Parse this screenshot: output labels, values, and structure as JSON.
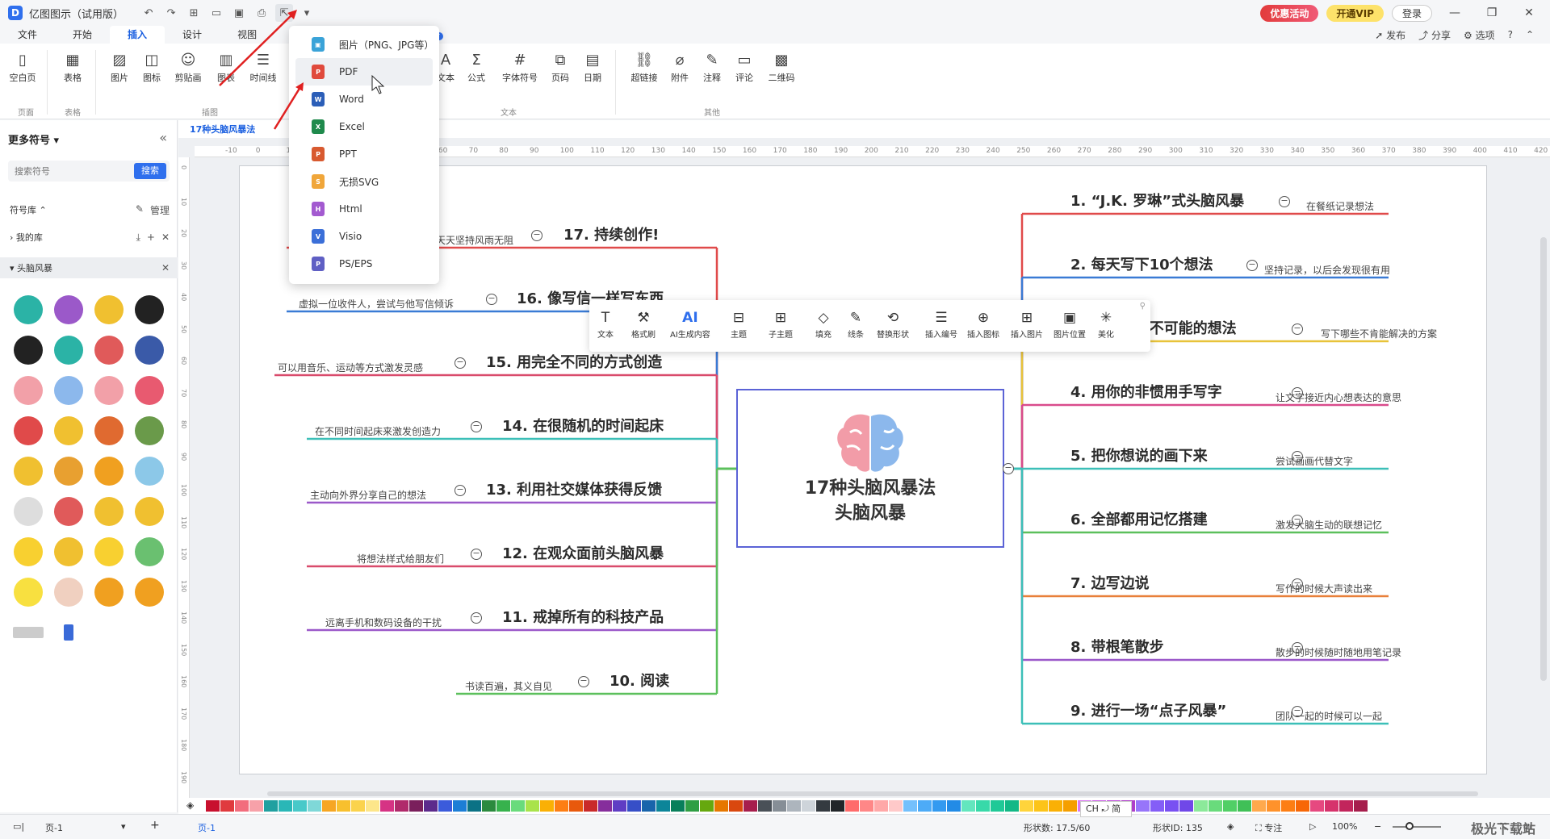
{
  "app": {
    "logo": "D",
    "title": "亿图图示（试用版）"
  },
  "titlebar": {
    "promo": "优惠活动",
    "vip": "开通VIP",
    "login": "登录"
  },
  "menu_tabs": [
    "文件",
    "开始",
    "插入",
    "设计",
    "视图"
  ],
  "menu_ai": "AI",
  "menu_hot": "hot",
  "menu_right": {
    "publish": "发布",
    "share": "分享",
    "options": "选项"
  },
  "ribbon": {
    "buttons": [
      "空白页",
      "表格",
      "图片",
      "图标",
      "剪贴画",
      "图表",
      "时间线",
      "文本",
      "公式",
      "字体符号",
      "页码",
      "日期",
      "超链接",
      "附件",
      "注释",
      "评论",
      "二维码"
    ],
    "groups": [
      "页面",
      "表格",
      "插图",
      "文本",
      "其他"
    ]
  },
  "export_menu": [
    {
      "label": "图片（PNG、JPG等）",
      "color": "#3aa3d8",
      "icon": "image-icon"
    },
    {
      "label": "PDF",
      "color": "#e04a3c",
      "icon": "pdf-icon"
    },
    {
      "label": "Word",
      "color": "#2b5eb8",
      "icon": "word-icon"
    },
    {
      "label": "Excel",
      "color": "#1f8a4c",
      "icon": "excel-icon"
    },
    {
      "label": "PPT",
      "color": "#d85a30",
      "icon": "ppt-icon"
    },
    {
      "label": "无损SVG",
      "color": "#f0a63a",
      "icon": "svg-icon"
    },
    {
      "label": "Html",
      "color": "#a35ad0",
      "icon": "html-icon"
    },
    {
      "label": "Visio",
      "color": "#3b6fd8",
      "icon": "visio-icon"
    },
    {
      "label": "PS/EPS",
      "color": "#5f5fc4",
      "icon": "ps-icon"
    }
  ],
  "left_panel": {
    "title": "更多符号",
    "search_placeholder": "搜索符号",
    "search_btn": "搜索",
    "library": "符号库",
    "manage": "管理",
    "my_lib": "我的库",
    "category": "头脑风暴"
  },
  "doc_tab": "17种头脑风暴法",
  "ruler_h": [
    "-10",
    "0",
    "10",
    "20",
    "30",
    "40",
    "50",
    "60",
    "70",
    "80",
    "90",
    "100",
    "110",
    "120",
    "130",
    "140",
    "150",
    "160",
    "170",
    "180",
    "190",
    "200",
    "210",
    "220",
    "230",
    "240",
    "250",
    "260",
    "270",
    "280",
    "290",
    "300",
    "310",
    "320",
    "330",
    "340",
    "350",
    "360",
    "370",
    "380",
    "390",
    "400",
    "410",
    "420"
  ],
  "ruler_v": [
    "0",
    "10",
    "20",
    "30",
    "40",
    "50",
    "60",
    "70",
    "80",
    "90",
    "100",
    "110",
    "120",
    "130",
    "140",
    "150",
    "160",
    "170",
    "180",
    "190",
    "200"
  ],
  "center": {
    "line1": "17种头脑风暴法",
    "line2": "头脑风暴"
  },
  "right_topics": [
    {
      "title": "1. “J.K. 罗琳”式头脑风暴",
      "note": "在餐纸记录想法",
      "color": "#e04a4a"
    },
    {
      "title": "2. 每天写下10个想法",
      "note": "坚持记录，以后会发现很有用",
      "color": "#3a7bd5"
    },
    {
      "title": "3. 写下每个不可能的想法",
      "note": "写下哪些不肯能解决的方案",
      "color": "#e8c33a"
    },
    {
      "title": "4. 用你的非惯用手写字",
      "note": "让文字接近内心想表达的意思",
      "color": "#d94b8c"
    },
    {
      "title": "5. 把你想说的画下来",
      "note": "尝试画画代替文字",
      "color": "#3cbfb8"
    },
    {
      "title": "6. 全部都用记忆搭建",
      "note": "激发大脑生动的联想记忆",
      "color": "#5cc05c"
    },
    {
      "title": "7. 边写边说",
      "note": "写作的时候大声读出来",
      "color": "#e8803a"
    },
    {
      "title": "8. 带根笔散步",
      "note": "散步的时候随时随地用笔记录",
      "color": "#9b59c9"
    },
    {
      "title": "9. 进行一场“点子风暴”",
      "note": "团队一起的时候可以一起",
      "color": "#3cbfb8"
    }
  ],
  "left_topics": [
    {
      "title": "17. 持续创作!",
      "note": "天天坚持风雨无阻",
      "color": "#e04a4a"
    },
    {
      "title": "16. 像写信一样写东西",
      "note": "虚拟一位收件人，尝试与他写信倾诉",
      "color": "#3a7bd5"
    },
    {
      "title": "15. 用完全不同的方式创造",
      "note": "可以用音乐、运动等方式激发灵感",
      "color": "#d94b6c"
    },
    {
      "title": "14. 在很随机的时间起床",
      "note": "在不同时间起床来激发创造力",
      "color": "#3cbfb8"
    },
    {
      "title": "13. 利用社交媒体获得反馈",
      "note": "主动向外界分享自己的想法",
      "color": "#9b59c9"
    },
    {
      "title": "12. 在观众面前头脑风暴",
      "note": "将想法样式给朋友们",
      "color": "#d94b6c"
    },
    {
      "title": "11. 戒掉所有的科技产品",
      "note": "远离手机和数码设备的干扰",
      "color": "#9b59c9"
    },
    {
      "title": "10. 阅读",
      "note": "书读百遍，其义自见",
      "color": "#5cc05c"
    }
  ],
  "float_toolbar": [
    "文本",
    "格式刷",
    "AI生成内容",
    "主题",
    "子主题",
    "填充",
    "线条",
    "替换形状",
    "插入编号",
    "插入图标",
    "插入图片",
    "图片位置",
    "美化"
  ],
  "status": {
    "page_label": "页-1",
    "page_tab": "页-1",
    "shapes_label": "形状数:",
    "shapes_value": "17.5/60",
    "shape_id_label": "形状ID:",
    "shape_id_value": "135",
    "focus": "专注",
    "zoom": "100%",
    "ime": "CH ⤾ 简",
    "watermark": "极光下载站"
  },
  "palette_colors": [
    "#c8102e",
    "#e03a3e",
    "#f26d7d",
    "#f7a1a9",
    "#20a0a0",
    "#2ab7b7",
    "#48c9c9",
    "#7fd8d8",
    "#f6a623",
    "#f8c02e",
    "#fbd34d",
    "#fde68a",
    "#d63384",
    "#b02a6b",
    "#7a1f5c",
    "#5c2a8c",
    "#3b5bdb",
    "#1c7ed6",
    "#0b7285",
    "#2b8a3e",
    "#37b24d",
    "#69db7c",
    "#a9e34b",
    "#fab005",
    "#fd7e14",
    "#e8590c",
    "#c92a2a",
    "#862e9c",
    "#5f3dc4",
    "#364fc7",
    "#1864ab",
    "#0c8599",
    "#087f5b",
    "#2f9e44",
    "#66a80f",
    "#e67700",
    "#d9480f",
    "#a61e4d",
    "#495057",
    "#868e96",
    "#adb5bd",
    "#ced4da",
    "#343a40",
    "#212529",
    "#ff6b6b",
    "#ff8787",
    "#ffa8a8",
    "#ffc9c9",
    "#74c0fc",
    "#4dabf7",
    "#339af0",
    "#228be6",
    "#63e6be",
    "#38d9a9",
    "#20c997",
    "#12b886",
    "#ffd43b",
    "#fcc419",
    "#fab005",
    "#f59f00",
    "#da77f2",
    "#cc5de8",
    "#be4bdb",
    "#ae3ec9",
    "#9775fa",
    "#845ef7",
    "#7950f2",
    "#7048e8",
    "#8ce99a",
    "#69db7c",
    "#51cf66",
    "#40c057",
    "#ffa94d",
    "#ff922b",
    "#fd7e14",
    "#f76707",
    "#e64980",
    "#d6336c",
    "#c2255c",
    "#a61e4d"
  ]
}
